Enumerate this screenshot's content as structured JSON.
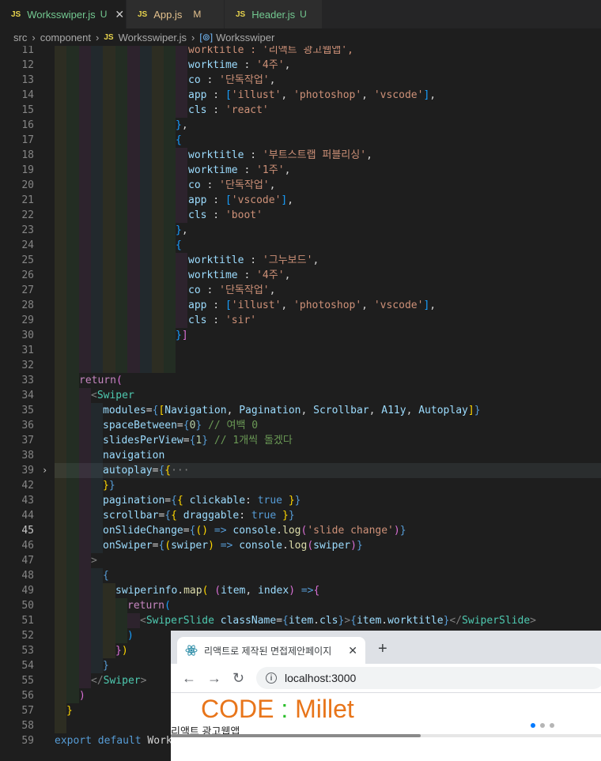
{
  "tabs": [
    {
      "label": "Worksswiper.js",
      "flag": "U",
      "flag_type": "u",
      "active": true,
      "has_close": true
    },
    {
      "label": "App.js",
      "flag": "M",
      "flag_type": "m",
      "active": false,
      "has_close": false
    },
    {
      "label": "Header.js",
      "flag": "U",
      "flag_type": "u",
      "active": false,
      "has_close": false
    }
  ],
  "breadcrumb": {
    "part1": "src",
    "part2": "component",
    "file": "Worksswiper.js",
    "symbol": "Worksswiper"
  },
  "editor": {
    "current_line": 45,
    "lines": [
      {
        "n": "11",
        "t": [
          [
            "str",
            "worktitle : '리액트 광고웹앱',"
          ]
        ]
      },
      {
        "n": "12",
        "t": [
          [
            "var",
            "worktime"
          ],
          [
            "txt",
            " : "
          ],
          [
            "str",
            "'4주'"
          ],
          [
            "txt",
            ","
          ]
        ]
      },
      {
        "n": "13",
        "t": [
          [
            "var",
            "co"
          ],
          [
            "txt",
            " : "
          ],
          [
            "str",
            "'단독작업'"
          ],
          [
            "txt",
            ","
          ]
        ]
      },
      {
        "n": "14",
        "t": [
          [
            "var",
            "app"
          ],
          [
            "txt",
            " : "
          ],
          [
            "b3",
            "["
          ],
          [
            "str",
            "'illust'"
          ],
          [
            "txt",
            ", "
          ],
          [
            "str",
            "'photoshop'"
          ],
          [
            "txt",
            ", "
          ],
          [
            "str",
            "'vscode'"
          ],
          [
            "b3",
            "]"
          ],
          [
            "txt",
            ","
          ]
        ]
      },
      {
        "n": "15",
        "t": [
          [
            "var",
            "cls"
          ],
          [
            "txt",
            " : "
          ],
          [
            "str",
            "'react'"
          ]
        ]
      },
      {
        "n": "16",
        "t": [
          [
            "b3",
            "}"
          ],
          [
            "txt",
            ","
          ]
        ]
      },
      {
        "n": "17",
        "t": [
          [
            "b3",
            "{"
          ]
        ]
      },
      {
        "n": "18",
        "t": [
          [
            "var",
            "worktitle"
          ],
          [
            "txt",
            " : "
          ],
          [
            "str",
            "'부트스트랩 퍼블리싱'"
          ],
          [
            "txt",
            ","
          ]
        ]
      },
      {
        "n": "19",
        "t": [
          [
            "var",
            "worktime"
          ],
          [
            "txt",
            " : "
          ],
          [
            "str",
            "'1주'"
          ],
          [
            "txt",
            ","
          ]
        ]
      },
      {
        "n": "20",
        "t": [
          [
            "var",
            "co"
          ],
          [
            "txt",
            " : "
          ],
          [
            "str",
            "'단독작업'"
          ],
          [
            "txt",
            ","
          ]
        ]
      },
      {
        "n": "21",
        "t": [
          [
            "var",
            "app"
          ],
          [
            "txt",
            " : "
          ],
          [
            "b3",
            "["
          ],
          [
            "str",
            "'vscode'"
          ],
          [
            "b3",
            "]"
          ],
          [
            "txt",
            ","
          ]
        ]
      },
      {
        "n": "22",
        "t": [
          [
            "var",
            "cls"
          ],
          [
            "txt",
            " : "
          ],
          [
            "str",
            "'boot'"
          ]
        ]
      },
      {
        "n": "23",
        "t": [
          [
            "b3",
            "}"
          ],
          [
            "txt",
            ","
          ]
        ]
      },
      {
        "n": "24",
        "t": [
          [
            "b3",
            "{"
          ]
        ]
      },
      {
        "n": "25",
        "t": [
          [
            "var",
            "worktitle"
          ],
          [
            "txt",
            " : "
          ],
          [
            "str",
            "'그누보드'"
          ],
          [
            "txt",
            ","
          ]
        ]
      },
      {
        "n": "26",
        "t": [
          [
            "var",
            "worktime"
          ],
          [
            "txt",
            " : "
          ],
          [
            "str",
            "'4주'"
          ],
          [
            "txt",
            ","
          ]
        ]
      },
      {
        "n": "27",
        "t": [
          [
            "var",
            "co"
          ],
          [
            "txt",
            " : "
          ],
          [
            "str",
            "'단독작업'"
          ],
          [
            "txt",
            ","
          ]
        ]
      },
      {
        "n": "28",
        "t": [
          [
            "var",
            "app"
          ],
          [
            "txt",
            " : "
          ],
          [
            "b3",
            "["
          ],
          [
            "str",
            "'illust'"
          ],
          [
            "txt",
            ", "
          ],
          [
            "str",
            "'photoshop'"
          ],
          [
            "txt",
            ", "
          ],
          [
            "str",
            "'vscode'"
          ],
          [
            "b3",
            "]"
          ],
          [
            "txt",
            ","
          ]
        ]
      },
      {
        "n": "29",
        "t": [
          [
            "var",
            "cls"
          ],
          [
            "txt",
            " : "
          ],
          [
            "str",
            "'sir'"
          ]
        ]
      },
      {
        "n": "30",
        "t": [
          [
            "b3",
            "}"
          ],
          [
            "b2",
            "]"
          ]
        ]
      },
      {
        "n": "31",
        "t": []
      },
      {
        "n": "32",
        "t": []
      },
      {
        "n": "33",
        "t": [
          [
            "kp",
            "return"
          ],
          [
            "b2",
            "("
          ]
        ]
      },
      {
        "n": "34",
        "t": [
          [
            "pun",
            "<"
          ],
          [
            "tag",
            "Swiper"
          ]
        ]
      },
      {
        "n": "35",
        "t": [
          [
            "var",
            "modules"
          ],
          [
            "txt",
            "="
          ],
          [
            "k",
            "{"
          ],
          [
            "b1",
            "["
          ],
          [
            "var",
            "Navigation"
          ],
          [
            "txt",
            ", "
          ],
          [
            "var",
            "Pagination"
          ],
          [
            "txt",
            ", "
          ],
          [
            "var",
            "Scrollbar"
          ],
          [
            "txt",
            ", "
          ],
          [
            "var",
            "A11y"
          ],
          [
            "txt",
            ", "
          ],
          [
            "var",
            "Autoplay"
          ],
          [
            "b1",
            "]"
          ],
          [
            "k",
            "}"
          ]
        ]
      },
      {
        "n": "36",
        "t": [
          [
            "var",
            "spaceBetween"
          ],
          [
            "txt",
            "="
          ],
          [
            "k",
            "{"
          ],
          [
            "num",
            "0"
          ],
          [
            "k",
            "}"
          ],
          [
            "txt",
            " "
          ],
          [
            "cm",
            "// 여백 0"
          ]
        ]
      },
      {
        "n": "37",
        "t": [
          [
            "var",
            "slidesPerView"
          ],
          [
            "txt",
            "="
          ],
          [
            "k",
            "{"
          ],
          [
            "num",
            "1"
          ],
          [
            "k",
            "}"
          ],
          [
            "txt",
            " "
          ],
          [
            "cm",
            "// 1개씩 돌겠다"
          ]
        ]
      },
      {
        "n": "38",
        "t": [
          [
            "var",
            "navigation"
          ]
        ]
      },
      {
        "n": "39",
        "t": [
          [
            "var",
            "autoplay"
          ],
          [
            "txt",
            "="
          ],
          [
            "k",
            "{"
          ],
          [
            "b1",
            "{"
          ],
          [
            "pun",
            "···"
          ]
        ],
        "fold": true,
        "hl": true
      },
      {
        "n": "42",
        "t": [
          [
            "b1",
            "}"
          ],
          [
            "k",
            "}"
          ]
        ]
      },
      {
        "n": "43",
        "t": [
          [
            "var",
            "pagination"
          ],
          [
            "txt",
            "="
          ],
          [
            "k",
            "{"
          ],
          [
            "b1",
            "{"
          ],
          [
            "txt",
            " "
          ],
          [
            "var",
            "clickable"
          ],
          [
            "txt",
            ": "
          ],
          [
            "k",
            "true"
          ],
          [
            "txt",
            " "
          ],
          [
            "b1",
            "}"
          ],
          [
            "k",
            "}"
          ]
        ]
      },
      {
        "n": "44",
        "t": [
          [
            "var",
            "scrollbar"
          ],
          [
            "txt",
            "="
          ],
          [
            "k",
            "{"
          ],
          [
            "b1",
            "{"
          ],
          [
            "txt",
            " "
          ],
          [
            "var",
            "draggable"
          ],
          [
            "txt",
            ": "
          ],
          [
            "k",
            "true"
          ],
          [
            "txt",
            " "
          ],
          [
            "b1",
            "}"
          ],
          [
            "k",
            "}"
          ]
        ]
      },
      {
        "n": "45",
        "t": [
          [
            "var",
            "onSlideChange"
          ],
          [
            "txt",
            "="
          ],
          [
            "k",
            "{"
          ],
          [
            "b1",
            "("
          ],
          [
            "b1",
            ")"
          ],
          [
            "txt",
            " "
          ],
          [
            "k",
            "=>"
          ],
          [
            "txt",
            " "
          ],
          [
            "var",
            "console"
          ],
          [
            "txt",
            "."
          ],
          [
            "fn",
            "log"
          ],
          [
            "b2",
            "("
          ],
          [
            "str",
            "'slide change'"
          ],
          [
            "b2",
            ")"
          ],
          [
            "k",
            "}"
          ]
        ]
      },
      {
        "n": "46",
        "t": [
          [
            "var",
            "onSwiper"
          ],
          [
            "txt",
            "="
          ],
          [
            "k",
            "{"
          ],
          [
            "b1",
            "("
          ],
          [
            "var",
            "swiper"
          ],
          [
            "b1",
            ")"
          ],
          [
            "txt",
            " "
          ],
          [
            "k",
            "=>"
          ],
          [
            "txt",
            " "
          ],
          [
            "var",
            "console"
          ],
          [
            "txt",
            "."
          ],
          [
            "fn",
            "log"
          ],
          [
            "b2",
            "("
          ],
          [
            "var",
            "swiper"
          ],
          [
            "b2",
            ")"
          ],
          [
            "k",
            "}"
          ]
        ]
      },
      {
        "n": "47",
        "t": [
          [
            "pun",
            ">"
          ]
        ]
      },
      {
        "n": "48",
        "t": [
          [
            "k",
            "{"
          ]
        ]
      },
      {
        "n": "49",
        "t": [
          [
            "var",
            "swiperinfo"
          ],
          [
            "txt",
            "."
          ],
          [
            "fn",
            "map"
          ],
          [
            "b1",
            "("
          ],
          [
            "txt",
            " "
          ],
          [
            "b2",
            "("
          ],
          [
            "var",
            "item"
          ],
          [
            "txt",
            ", "
          ],
          [
            "var",
            "index"
          ],
          [
            "b2",
            ")"
          ],
          [
            "txt",
            " "
          ],
          [
            "k",
            "=>"
          ],
          [
            "b2",
            "{"
          ]
        ]
      },
      {
        "n": "50",
        "t": [
          [
            "kp",
            "return"
          ],
          [
            "b3",
            "("
          ]
        ]
      },
      {
        "n": "51",
        "t": [
          [
            "pun",
            "<"
          ],
          [
            "tag",
            "SwiperSlide"
          ],
          [
            "txt",
            " "
          ],
          [
            "var",
            "className"
          ],
          [
            "txt",
            "="
          ],
          [
            "k",
            "{"
          ],
          [
            "var",
            "item"
          ],
          [
            "txt",
            "."
          ],
          [
            "var",
            "cls"
          ],
          [
            "k",
            "}"
          ],
          [
            "pun",
            ">"
          ],
          [
            "k",
            "{"
          ],
          [
            "var",
            "item"
          ],
          [
            "txt",
            "."
          ],
          [
            "var",
            "worktitle"
          ],
          [
            "k",
            "}"
          ],
          [
            "pun",
            "</"
          ],
          [
            "tag",
            "SwiperSlide"
          ],
          [
            "pun",
            ">"
          ]
        ]
      },
      {
        "n": "52",
        "t": [
          [
            "b3",
            ")"
          ]
        ]
      },
      {
        "n": "53",
        "t": [
          [
            "b2",
            "}"
          ],
          [
            "b1",
            ")"
          ]
        ]
      },
      {
        "n": "54",
        "t": [
          [
            "k",
            "}"
          ]
        ]
      },
      {
        "n": "55",
        "t": [
          [
            "pun",
            "</"
          ],
          [
            "tag",
            "Swiper"
          ],
          [
            "pun",
            ">"
          ]
        ]
      },
      {
        "n": "56",
        "t": [
          [
            "b2",
            ")"
          ]
        ]
      },
      {
        "n": "57",
        "t": [
          [
            "b1",
            "}"
          ]
        ]
      },
      {
        "n": "58",
        "t": []
      },
      {
        "n": "59",
        "t": [
          [
            "k",
            "export"
          ],
          [
            "txt",
            " "
          ],
          [
            "k",
            "default"
          ],
          [
            "txt",
            " "
          ],
          [
            "txt",
            "Worksswiper"
          ]
        ]
      }
    ]
  },
  "browser": {
    "tab_title": "리액트로 제작된 면접제안페이지",
    "new_tab_label": "+",
    "url": "localhost:3000",
    "logo": {
      "part1": "CODE",
      "part2": ":",
      "part3": "Millet"
    },
    "slide_text": "리액트 광고웹앱",
    "pagination_count": 3,
    "active_dot": 0,
    "scroll_fraction": 0.58
  }
}
